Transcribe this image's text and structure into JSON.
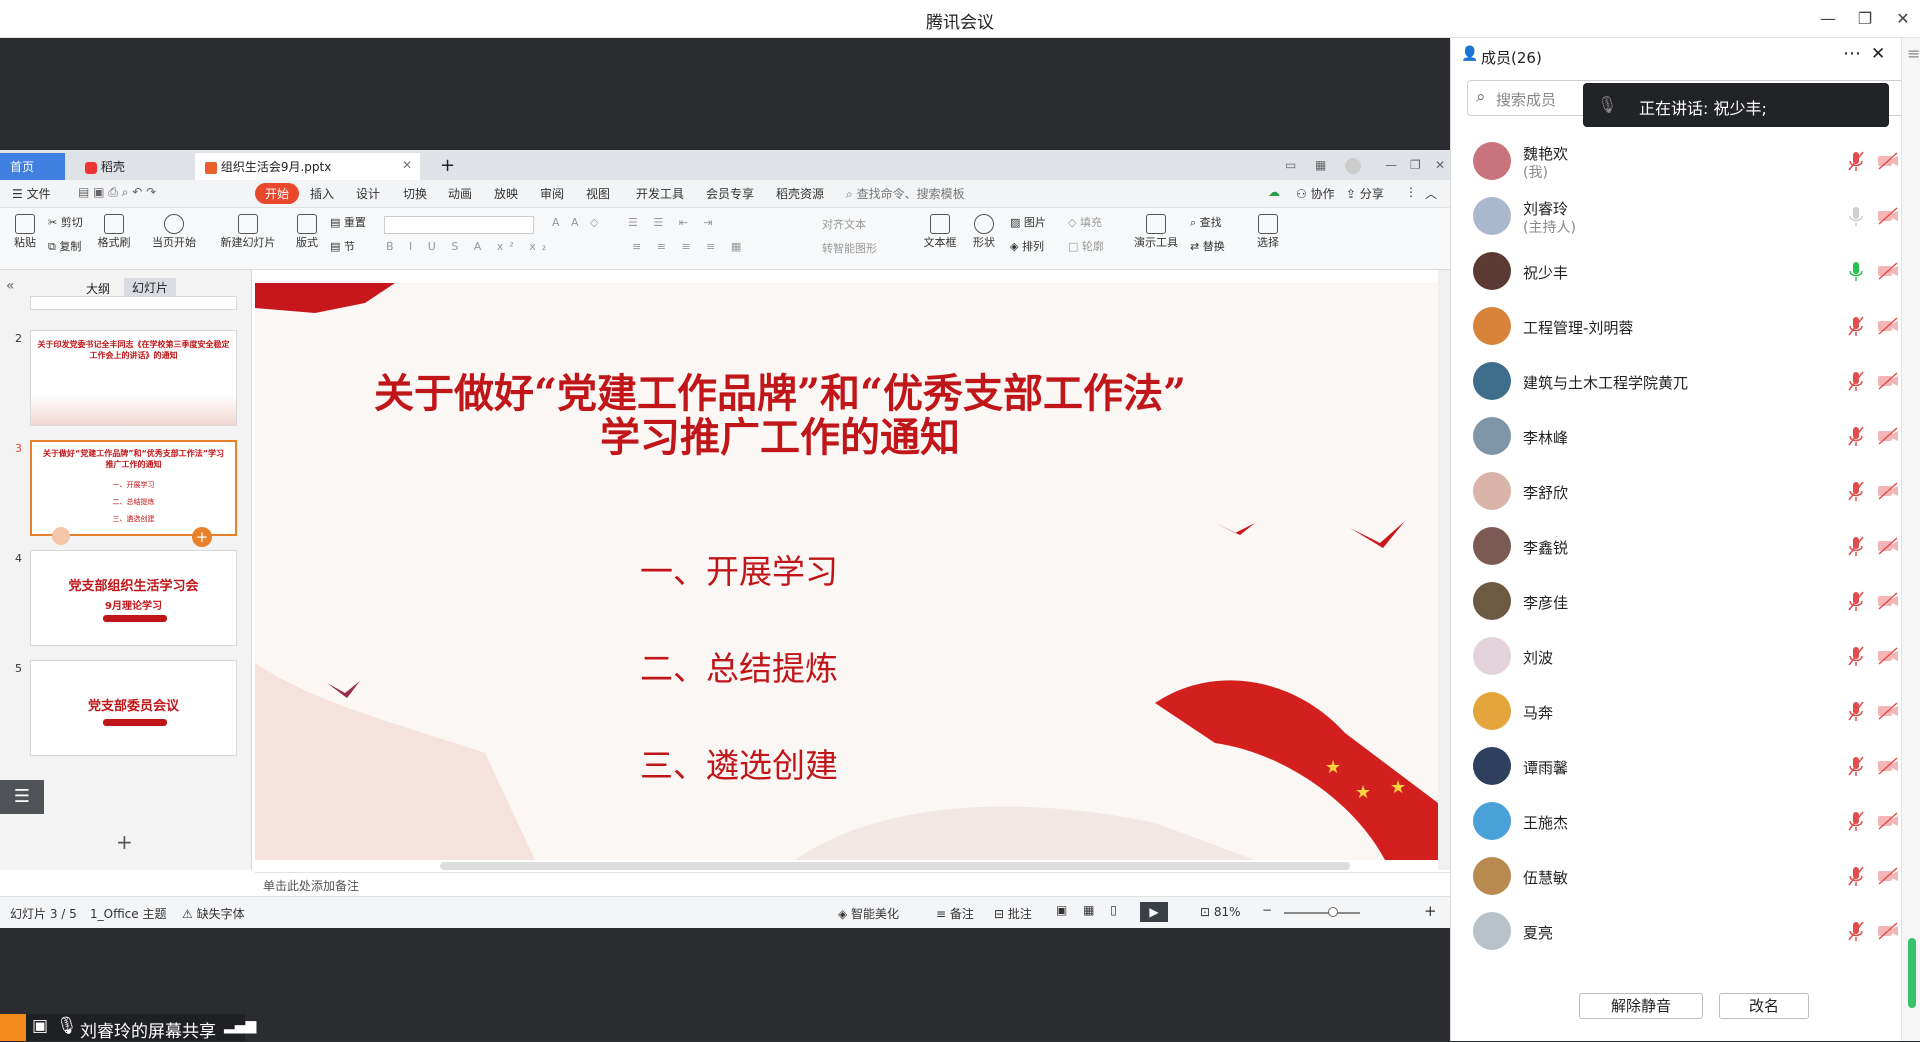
{
  "app_title": "腾讯会议",
  "wps": {
    "tabs": [
      {
        "label": "首页"
      },
      {
        "label": "稻壳"
      },
      {
        "label": "组织生活会9月.pptx"
      }
    ],
    "menu": [
      "文件",
      "开始",
      "插入",
      "设计",
      "切换",
      "动画",
      "放映",
      "审阅",
      "视图",
      "开发工具",
      "会员专享",
      "稻壳资源"
    ],
    "search_cmd": "查找命令、搜索模板",
    "collab": "协作",
    "share": "分享",
    "ribbon": {
      "paste": "粘贴",
      "cut": "剪切",
      "copy": "复制",
      "format_painter": "格式刷",
      "from_current": "当页开始",
      "new_slide": "新建幻灯片",
      "layout": "版式",
      "reset": "重置",
      "section": "节",
      "align_text": "对齐文本",
      "smart_art": "转智能图形",
      "textbox": "文本框",
      "shape": "形状",
      "picture": "图片",
      "arrange": "排列",
      "fill": "填充",
      "outline": "轮廓",
      "present_tools": "演示工具",
      "find": "查找",
      "replace": "替换",
      "select": "选择"
    },
    "pane_tabs": [
      "大纲",
      "幻灯片"
    ],
    "thumbnails": [
      {
        "num": "2",
        "title": "关于印发党委书记全丰同志《在学校第三季度安全稳定工作会上的讲话》的通知"
      },
      {
        "num": "3",
        "title": "关于做好“党建工作品牌”和“优秀支部工作法”学习推广工作的通知",
        "items": [
          "一、开展学习",
          "二、总结提炼",
          "三、遴选创建"
        ]
      },
      {
        "num": "4",
        "title": "党支部组织生活学习会",
        "sub": "9月理论学习"
      },
      {
        "num": "5",
        "title": "党支部委员会议"
      }
    ],
    "slide": {
      "title_line1": "关于做好“党建工作品牌”和“优秀支部工作法”",
      "title_line2": "学习推广工作的通知",
      "items": [
        "一、开展学习",
        "二、总结提炼",
        "三、遴选创建"
      ]
    },
    "notes_placeholder": "单击此处添加备注",
    "status": {
      "slide_index": "幻灯片 3 / 5",
      "theme": "1_Office 主题",
      "missing_font": "缺失字体",
      "smart_beautify": "智能美化",
      "notes": "备注",
      "comments": "批注",
      "zoom": "81%"
    }
  },
  "share_bar": {
    "label": "刘睿玲的屏幕共享"
  },
  "panel": {
    "header": "成员(26)",
    "search_placeholder": "搜索成员",
    "speaking": "正在讲话: 祝少丰;",
    "members": [
      {
        "name": "魏艳欢",
        "sub": "(我)",
        "avatar_color": "#c9737c",
        "mic": "muted"
      },
      {
        "name": "刘睿玲",
        "sub": "(主持人)",
        "avatar_color": "#a9b8cc",
        "mic": "off"
      },
      {
        "name": "祝少丰",
        "sub": "",
        "avatar_color": "#5a3a32",
        "mic": "active"
      },
      {
        "name": "工程管理-刘明蓉",
        "sub": "",
        "avatar_color": "#d7833a",
        "mic": "muted"
      },
      {
        "name": "建筑与土木工程学院黄兀",
        "sub": "",
        "avatar_color": "#3f6e8c",
        "mic": "muted"
      },
      {
        "name": "李林峰",
        "sub": "",
        "avatar_color": "#7e95a8",
        "mic": "muted"
      },
      {
        "name": "李舒欣",
        "sub": "",
        "avatar_color": "#d9b4a8",
        "mic": "muted"
      },
      {
        "name": "李鑫锐",
        "sub": "",
        "avatar_color": "#7a5a52",
        "mic": "muted"
      },
      {
        "name": "李彦佳",
        "sub": "",
        "avatar_color": "#6d5a43",
        "mic": "muted"
      },
      {
        "name": "刘波",
        "sub": "",
        "avatar_color": "#e3d2da",
        "mic": "muted"
      },
      {
        "name": "马奔",
        "sub": "",
        "avatar_color": "#e3a53c",
        "mic": "muted"
      },
      {
        "name": "谭雨馨",
        "sub": "",
        "avatar_color": "#2f3f5e",
        "mic": "muted"
      },
      {
        "name": "王施杰",
        "sub": "",
        "avatar_color": "#4aa0d8",
        "mic": "muted"
      },
      {
        "name": "伍慧敏",
        "sub": "",
        "avatar_color": "#b88a4f",
        "mic": "muted"
      },
      {
        "name": "夏亮",
        "sub": "",
        "avatar_color": "#b9c2c8",
        "mic": "muted"
      }
    ],
    "unmute_button": "解除静音",
    "rename_button": "改名"
  },
  "colors": {
    "wps_accent": "#e8492c",
    "slide_red": "#c0161a",
    "mic_active": "#27c24c",
    "muted_red": "#e24c4c"
  }
}
